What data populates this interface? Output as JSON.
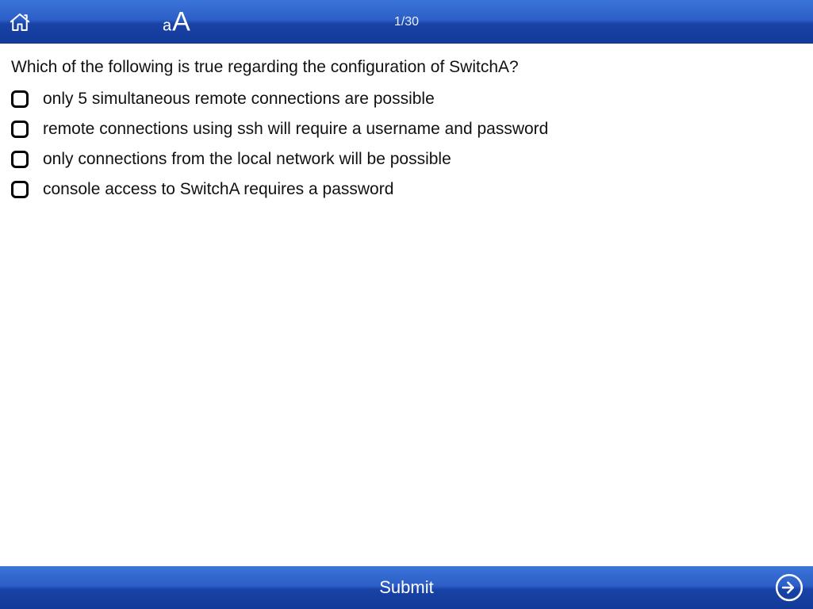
{
  "header": {
    "progress": "1/30"
  },
  "question": {
    "text": "Which of the following is true regarding the configuration of SwitchA?",
    "options": [
      {
        "label": "only 5 simultaneous remote connections are possible"
      },
      {
        "label": "remote connections using ssh will require a username and password"
      },
      {
        "label": "only connections from the local network will be possible"
      },
      {
        "label": "console access to SwitchA requires a password"
      }
    ]
  },
  "footer": {
    "submit_label": "Submit"
  }
}
